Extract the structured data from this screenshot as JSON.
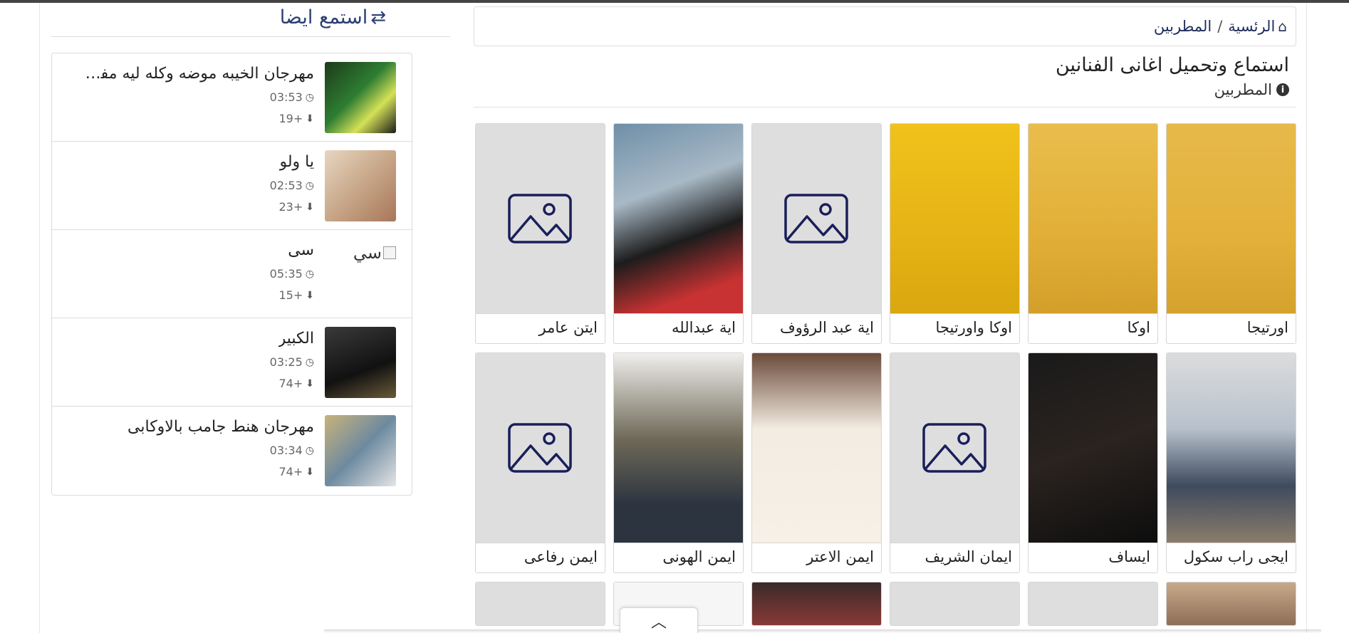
{
  "sidebar": {
    "title": "استمع ايضا",
    "shuffle_icon": "shuffle-icon",
    "items": [
      {
        "title": "مهرجان الخيبه موضه وكله ليه مفضل...",
        "duration": "03:53",
        "downloads": "+19"
      },
      {
        "title": "يا ولو",
        "duration": "02:53",
        "downloads": "+23"
      },
      {
        "title": "سى",
        "duration": "05:35",
        "downloads": "+15",
        "broken_alt": "سي"
      },
      {
        "title": "الكبير",
        "duration": "03:25",
        "downloads": "+74"
      },
      {
        "title": "مهرجان هنط جامب بالاوكابى",
        "duration": "03:34",
        "downloads": "+74"
      }
    ]
  },
  "breadcrumb": {
    "home": "الرئسية",
    "separator": "/",
    "current": "المطربين"
  },
  "main": {
    "title": "استماع وتحميل اغانى الفنانين",
    "subtitle": "المطربين"
  },
  "artists_row1": [
    "اورتيجا",
    "اوكا",
    "اوكا واورتيجا",
    "اية عبد الرؤوف",
    "اية عبدالله",
    "ايتن عامر"
  ],
  "artists_row2": [
    "ايجى راب سكول",
    "ايساف",
    "ايمان الشريف",
    "ايمن الاعتر",
    "ايمن الهونى",
    "ايمن رفاعى"
  ],
  "colors": {
    "accent": "#2c3e73",
    "border": "#dcdcdc",
    "placeholder": "#dedede"
  }
}
